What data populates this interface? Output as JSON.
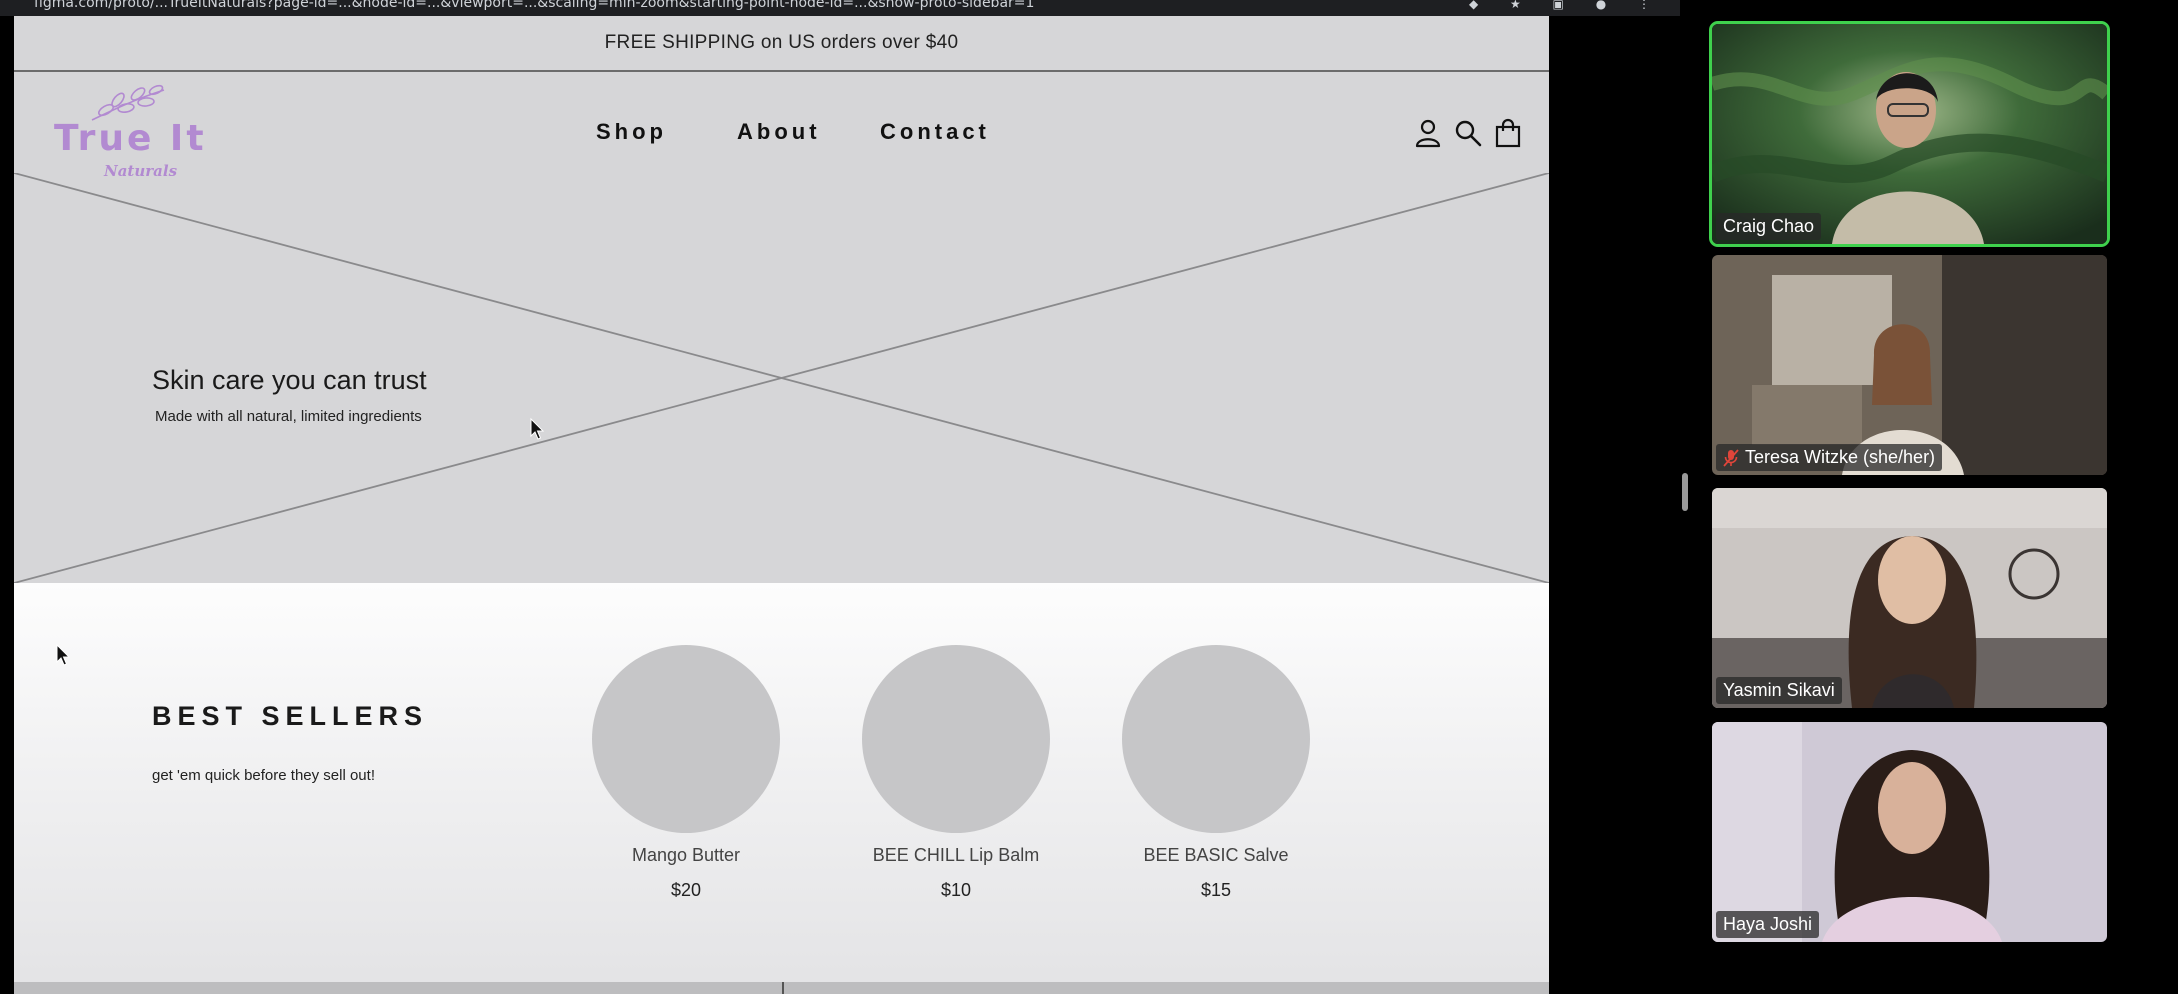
{
  "browser": {
    "url": "figma.com/proto/...TrueItNaturals?page-id=...&node-id=...&viewport=...&scaling=min-zoom&starting-point-node-id=...&show-proto-sidebar=1"
  },
  "site": {
    "announcement": "FREE SHIPPING on US orders over $40",
    "logo": {
      "brand": "True It",
      "sub": "Naturals"
    },
    "nav": {
      "shop": "Shop",
      "about": "About",
      "contact": "Contact"
    },
    "header_icons": [
      "account-icon",
      "search-icon",
      "shopping-bag-icon"
    ],
    "hero": {
      "title": "Skin care you can trust",
      "subtitle": "Made with all natural, limited ingredients"
    },
    "best_sellers": {
      "title": "BEST SELLERS",
      "subtitle": "get 'em quick before they sell out!",
      "products": [
        {
          "name": "Mango Butter",
          "price": "$20"
        },
        {
          "name": "BEE CHILL Lip Balm",
          "price": "$10"
        },
        {
          "name": "BEE BASIC Salve",
          "price": "$15"
        }
      ]
    },
    "colors": {
      "brand_purple": "#b28ad1",
      "placeholder_gray": "#d6d6d8"
    }
  },
  "call": {
    "participants": [
      {
        "name": "Craig Chao",
        "active_speaker": true,
        "muted": false
      },
      {
        "name": "Teresa Witzke (she/her)",
        "active_speaker": false,
        "muted": true
      },
      {
        "name": "Yasmin Sikavi",
        "active_speaker": false,
        "muted": false
      },
      {
        "name": "Haya Joshi",
        "active_speaker": false,
        "muted": false
      }
    ],
    "colors": {
      "active_border": "#3fd14d",
      "muted_icon": "#e0453a"
    }
  }
}
